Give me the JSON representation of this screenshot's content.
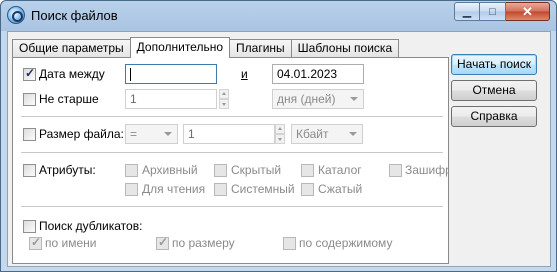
{
  "window": {
    "title": "Поиск файлов"
  },
  "caption_buttons": {
    "minimize": "▁",
    "maximize": "□",
    "close": "✕"
  },
  "tabs": [
    {
      "label": "Общие параметры",
      "active": false
    },
    {
      "label": "Дополнительно",
      "active": true
    },
    {
      "label": "Плагины",
      "active": false
    },
    {
      "label": "Шаблоны поиска",
      "active": false
    }
  ],
  "date": {
    "date_between_label": "Дата между",
    "date_between_checked": true,
    "from_value": "",
    "and_label": "и",
    "to_value": "04.01.2023",
    "not_older_label": "Не старше",
    "not_older_checked": false,
    "not_older_value": "1",
    "not_older_unit": "дня (дней)"
  },
  "size": {
    "label": "Размер файла:",
    "checked": false,
    "operator": "=",
    "value": "1",
    "unit": "Кбайт"
  },
  "attributes": {
    "label": "Атрибуты:",
    "checked": false,
    "archive": "Архивный",
    "hidden": "Скрытый",
    "directory": "Каталог",
    "encrypted": "Зашифр",
    "readonly": "Для чтения",
    "system": "Системный",
    "compressed": "Сжатый"
  },
  "duplicates": {
    "label": "Поиск дубликатов:",
    "checked": false,
    "by_name": "по имени",
    "by_name_checked": true,
    "by_size": "по размеру",
    "by_size_checked": true,
    "by_content": "по содержимому",
    "by_content_checked": false
  },
  "buttons": {
    "start": "Начать поиск",
    "cancel": "Отмена",
    "help": "Справка"
  }
}
